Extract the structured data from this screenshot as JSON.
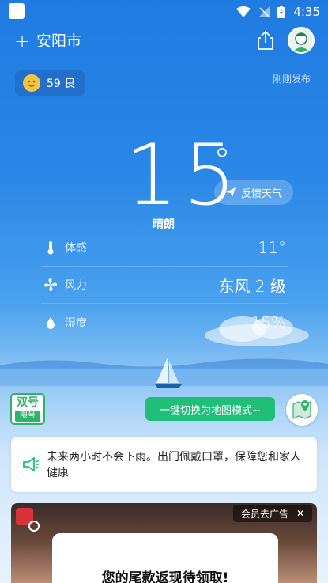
{
  "status": {
    "time": "4:35"
  },
  "header": {
    "plus": "+",
    "city": "安阳市"
  },
  "aqi": {
    "value": "59 良"
  },
  "publish": "刚刚发布",
  "current": {
    "temp": "15",
    "degree": "°",
    "condition": "晴朗",
    "feedback_label": "反馈天气"
  },
  "details": [
    {
      "label": "体感",
      "value": "11°",
      "icon": "thermometer-icon"
    },
    {
      "label": "风力",
      "value": "东风 2 级",
      "icon": "fan-icon"
    },
    {
      "label": "湿度",
      "value": "15%",
      "icon": "droplet-icon"
    }
  ],
  "badge": {
    "top": "双号",
    "bottom": "限号"
  },
  "map_switch": "一键切换为地图模式~",
  "tip": "未来两小时不会下雨。出门佩戴口罩，保障您和家人健康",
  "ad": {
    "vip": "会员去广告",
    "close": "✕",
    "title": "您的尾款返现待领取!"
  }
}
